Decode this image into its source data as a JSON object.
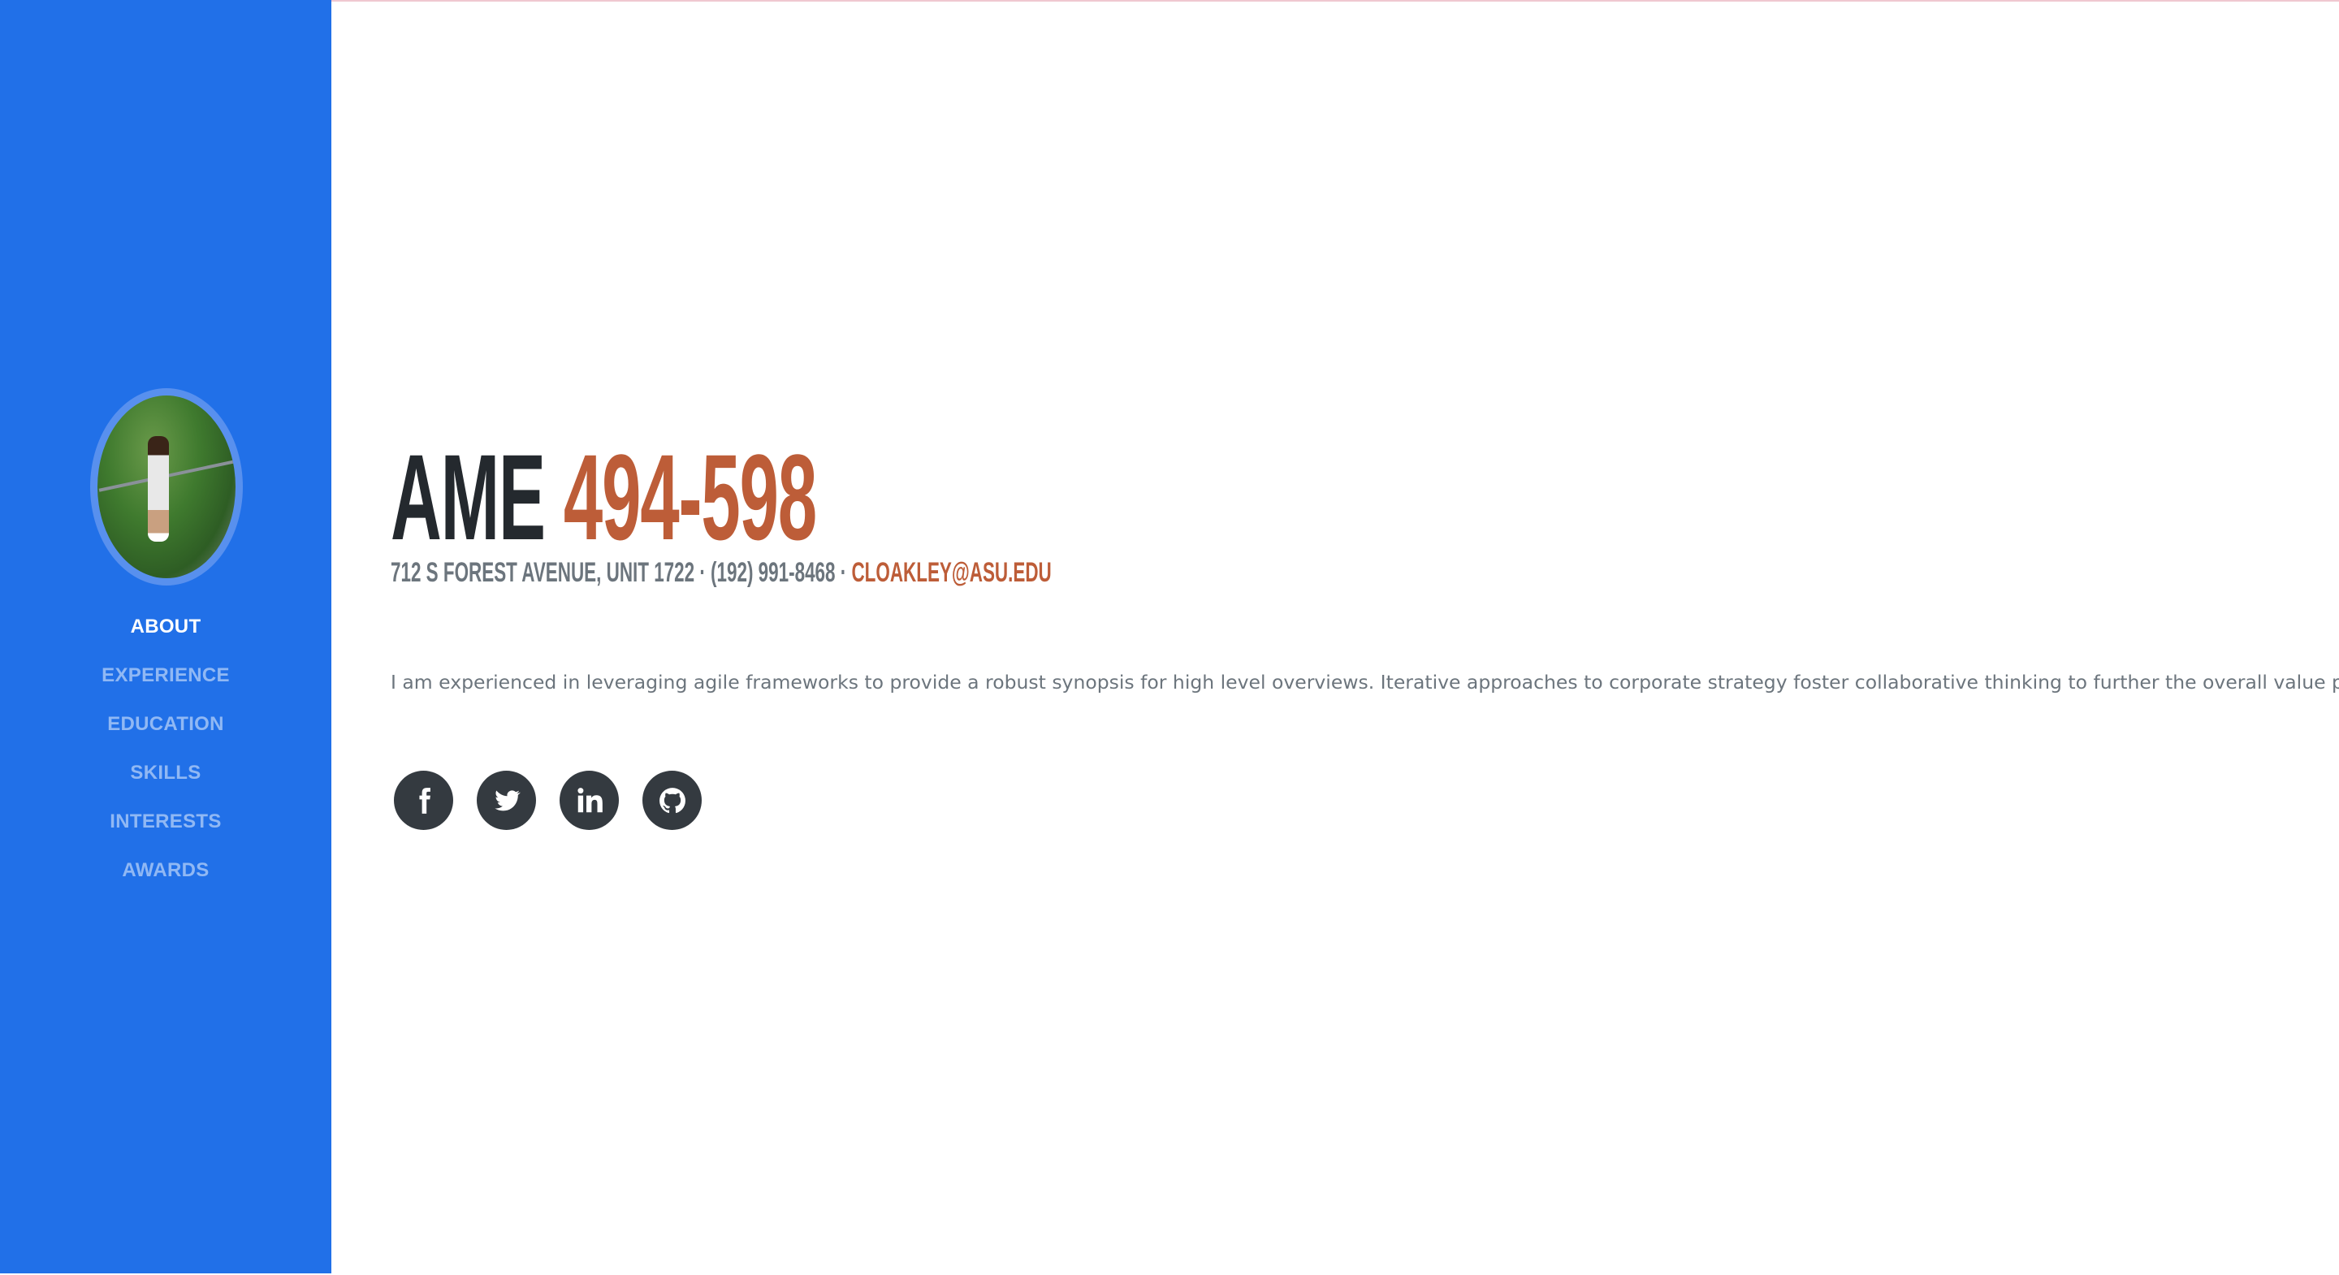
{
  "sidebar": {
    "nav": [
      {
        "label": "ABOUT",
        "active": true
      },
      {
        "label": "EXPERIENCE",
        "active": false
      },
      {
        "label": "EDUCATION",
        "active": false
      },
      {
        "label": "SKILLS",
        "active": false
      },
      {
        "label": "INTERESTS",
        "active": false
      },
      {
        "label": "AWARDS",
        "active": false
      }
    ]
  },
  "about": {
    "first_name": "AME",
    "last_name": "494-598",
    "address": "712 S FOREST AVENUE, UNIT 1722 · (192) 991-8468 · ",
    "email": "CLOAKLEY@ASU.EDU",
    "lead": "I am experienced in leveraging agile frameworks to provide a robust synopsis for high level overviews. Iterative approaches to corporate strategy foster collaborative thinking to further the overall value proposition.",
    "social": [
      "facebook-icon",
      "twitter-icon",
      "linkedin-icon",
      "github-icon"
    ]
  },
  "colors": {
    "sidebar": "#2170e8",
    "accent": "#bd5d38",
    "heading": "#24292e",
    "muted": "#6c757d",
    "social": "#343a40"
  }
}
